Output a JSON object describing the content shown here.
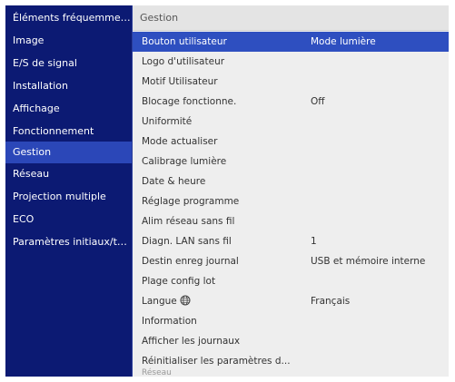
{
  "sidebar": {
    "items": [
      {
        "label": "Éléments fréquemmen..."
      },
      {
        "label": "Image"
      },
      {
        "label": "E/S de signal"
      },
      {
        "label": "Installation"
      },
      {
        "label": "Affichage"
      },
      {
        "label": "Fonctionnement"
      },
      {
        "label": "Gestion"
      },
      {
        "label": "Réseau"
      },
      {
        "label": "Projection multiple"
      },
      {
        "label": "ECO"
      },
      {
        "label": "Paramètres initiaux/to..."
      }
    ],
    "selected": "Gestion"
  },
  "panel": {
    "title": "Gestion",
    "rows": [
      {
        "label": "Bouton utilisateur",
        "value": "Mode lumière"
      },
      {
        "label": "Logo d'utilisateur",
        "value": ""
      },
      {
        "label": "Motif Utilisateur",
        "value": ""
      },
      {
        "label": "Blocage fonctionne.",
        "value": "Off"
      },
      {
        "label": "Uniformité",
        "value": ""
      },
      {
        "label": "Mode actualiser",
        "value": ""
      },
      {
        "label": "Calibrage lumière",
        "value": ""
      },
      {
        "label": "Date & heure",
        "value": ""
      },
      {
        "label": "Réglage programme",
        "value": ""
      },
      {
        "label": "Alim réseau sans fil",
        "value": ""
      },
      {
        "label": "Diagn. LAN sans fil",
        "value": "1"
      },
      {
        "label": "Destin enreg journal",
        "value": "USB et mémoire interne"
      },
      {
        "label": "Plage config lot",
        "value": ""
      },
      {
        "label": "Langue",
        "value": "Français",
        "icon": "globe-icon"
      },
      {
        "label": "Information",
        "value": ""
      },
      {
        "label": "Afficher les journaux",
        "value": ""
      },
      {
        "label": "Réinitialiser les paramètres d...",
        "value": ""
      }
    ],
    "footer_partial": "Réseau"
  }
}
